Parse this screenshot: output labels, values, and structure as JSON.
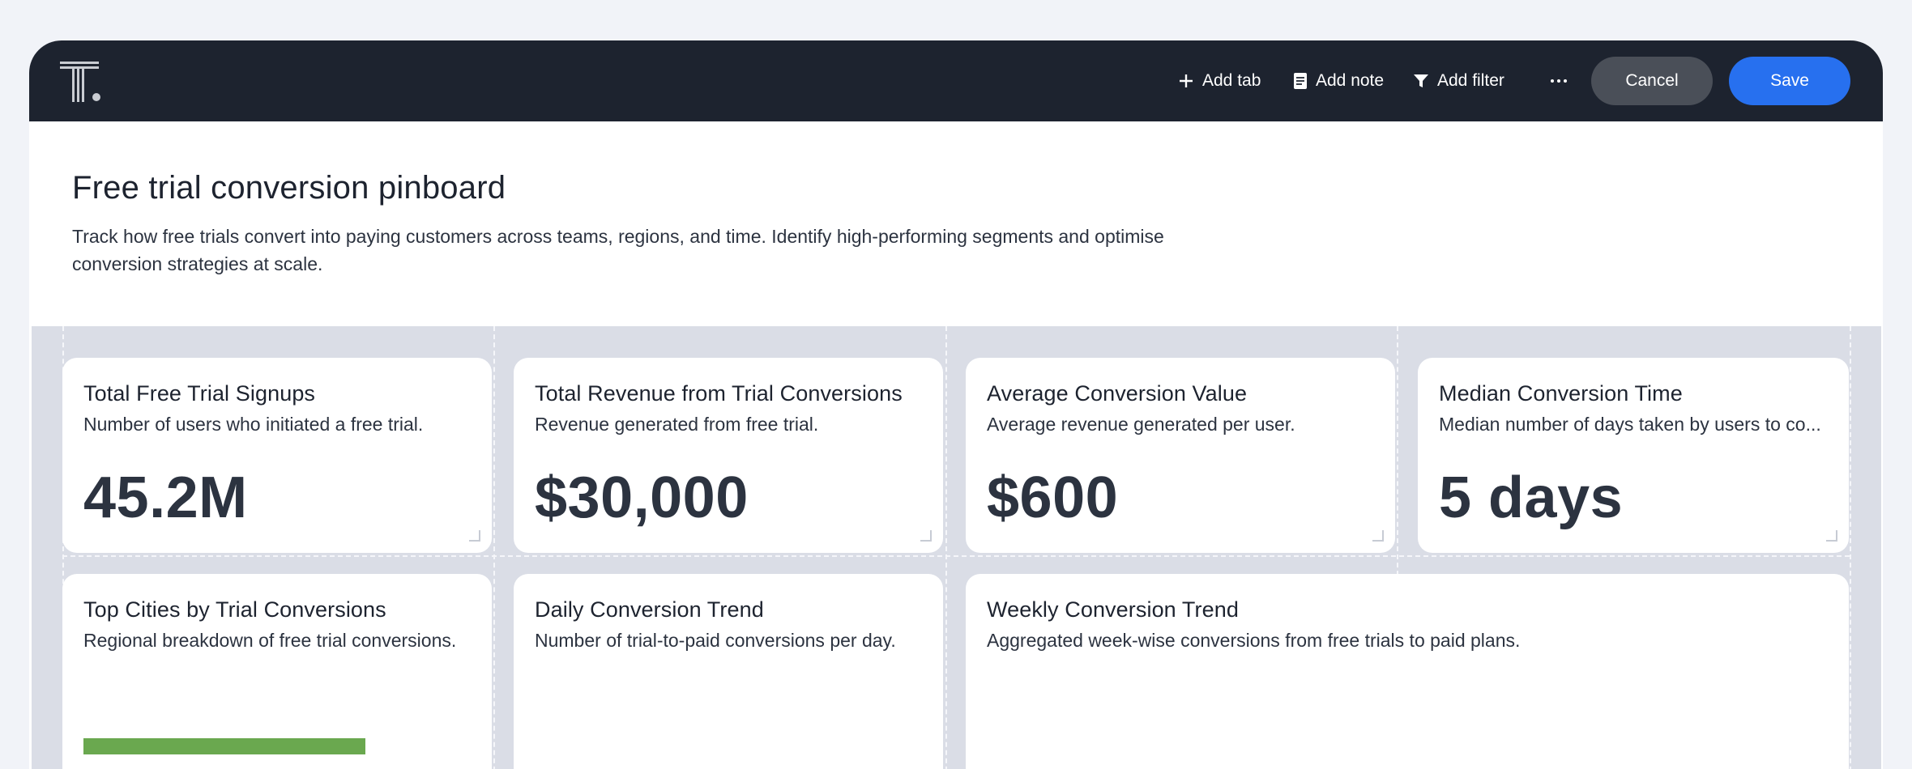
{
  "toolbar": {
    "add_tab": "Add tab",
    "add_note": "Add note",
    "add_filter": "Add filter",
    "cancel": "Cancel",
    "save": "Save"
  },
  "header": {
    "title": "Free trial conversion pinboard",
    "description": "Track how free trials convert into paying customers across teams, regions, and time. Identify high-performing segments and optimise conversion strategies at scale."
  },
  "cards": [
    {
      "title": "Total Free Trial Signups",
      "subtitle": "Number of users who initiated a free trial.",
      "value": "45.2M"
    },
    {
      "title": "Total Revenue from Trial Conversions",
      "subtitle": "Revenue generated from free trial.",
      "value": "$30,000"
    },
    {
      "title": "Average Conversion Value",
      "subtitle": "Average revenue generated per user.",
      "value": "$600"
    },
    {
      "title": "Median Conversion Time",
      "subtitle": "Median number of days taken by users to co...",
      "value": "5 days"
    },
    {
      "title": "Top Cities by Trial Conversions",
      "subtitle": "Regional breakdown of free trial conversions."
    },
    {
      "title": "Daily Conversion Trend",
      "subtitle": "Number of trial-to-paid conversions per day."
    },
    {
      "title": "Weekly Conversion Trend",
      "subtitle": "Aggregated week-wise conversions from free trials to paid plans."
    }
  ],
  "colors": {
    "topbar": "#1d232f",
    "save_button": "#2770ef",
    "cancel_button": "#4a4f58",
    "canvas": "#dadde6",
    "bar": "#6aa84f"
  }
}
